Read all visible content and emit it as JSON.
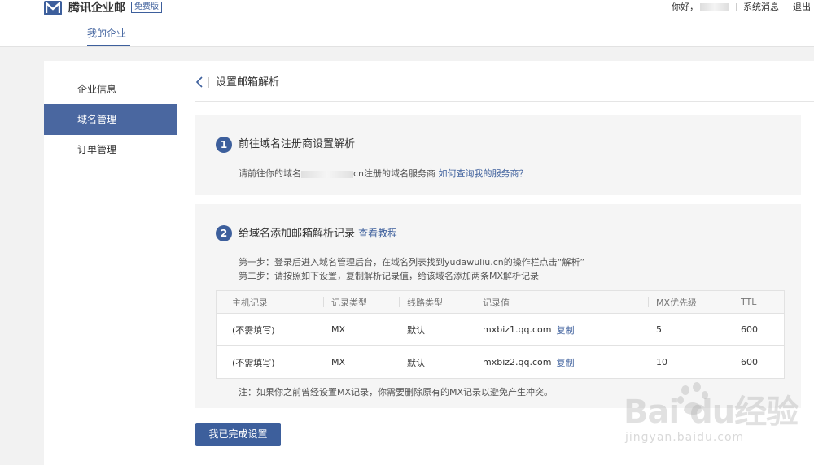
{
  "header": {
    "brand": "腾讯企业邮",
    "edition": "免费版",
    "greeting": "你好，",
    "messages_link": "系统消息",
    "logout_link": "退出"
  },
  "nav": {
    "tab_label": "我的企业"
  },
  "sidebar": {
    "items": [
      {
        "label": "企业信息"
      },
      {
        "label": "域名管理"
      },
      {
        "label": "订单管理"
      }
    ]
  },
  "page": {
    "title": "设置邮箱解析"
  },
  "step1": {
    "number": "1",
    "title": "前往域名注册商设置解析",
    "desc_prefix": "请前往你的域名",
    "desc_suffix": "cn注册的域名服务商",
    "help_link": "如何查询我的服务商？"
  },
  "step2": {
    "number": "2",
    "title": "给域名添加邮箱解析记录",
    "tutorial_link": "查看教程",
    "instr1": "第一步：登录后进入域名管理后台，在域名列表找到yudawuliu.cn的操作栏点击“解析”",
    "instr2": "第二步：请按照如下设置，复制解析记录值，给该域名添加两条MX解析记录",
    "table": {
      "headers": [
        "主机记录",
        "记录类型",
        "线路类型",
        "记录值",
        "MX优先级",
        "TTL"
      ],
      "rows": [
        {
          "host": "(不需填写)",
          "type": "MX",
          "line": "默认",
          "value": "mxbiz1.qq.com",
          "copy": "复制",
          "priority": "5",
          "ttl": "600"
        },
        {
          "host": "(不需填写)",
          "type": "MX",
          "line": "默认",
          "value": "mxbiz2.qq.com",
          "copy": "复制",
          "priority": "10",
          "ttl": "600"
        }
      ]
    },
    "note": "注：如果你之前曾经设置MX记录，你需要删除原有的MX记录以避免产生冲突。"
  },
  "done_button": "我已完成设置",
  "watermark": {
    "logo": "Bai  du经验",
    "url": "jingyan.baidu.com"
  },
  "colors": {
    "accent": "#3d5f9c",
    "active_sidebar": "#4a67a0"
  }
}
